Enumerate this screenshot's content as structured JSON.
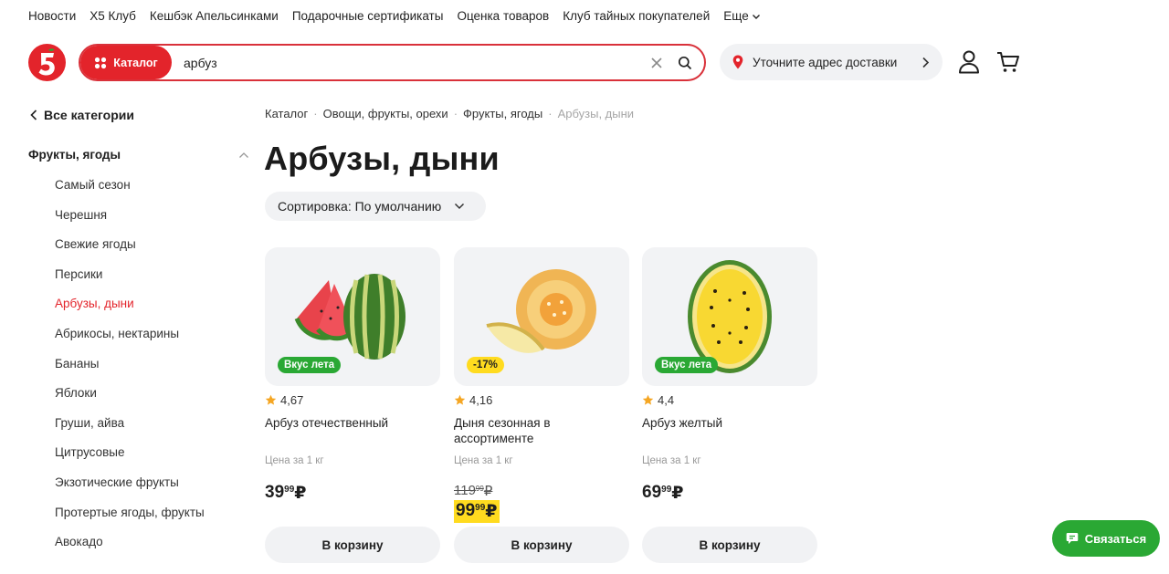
{
  "top_nav": [
    "Новости",
    "Х5 Клуб",
    "Кешбэк Апельсинками",
    "Подарочные сертификаты",
    "Оценка товаров",
    "Клуб тайных покупателей"
  ],
  "top_nav_more": "Еще",
  "header": {
    "catalog_label": "Каталог",
    "search_value": "арбуз",
    "address_label": "Уточните адрес доставки"
  },
  "sidebar": {
    "back_label": "Все категории",
    "category": "Фрукты, ягоды",
    "items": [
      "Самый сезон",
      "Черешня",
      "Свежие ягоды",
      "Персики",
      "Арбузы, дыни",
      "Абрикосы, нектарины",
      "Бананы",
      "Яблоки",
      "Груши, айва",
      "Цитрусовые",
      "Экзотические фрукты",
      "Протертые ягоды, фрукты",
      "Авокадо"
    ],
    "active_index": 4
  },
  "breadcrumb": [
    "Каталог",
    "Овощи, фрукты, орехи",
    "Фрукты, ягоды",
    "Арбузы, дыни"
  ],
  "page_title": "Арбузы, дыни",
  "sort_label": "Сортировка: По умолчанию",
  "products": [
    {
      "badge": "Вкус лета",
      "badge_color": "#2aa834",
      "rating": "4,67",
      "name": "Арбуз отечественный",
      "unit": "Цена за 1 кг",
      "price_rub": "39",
      "price_kop": "99",
      "currency": "₽",
      "button": "В корзину"
    },
    {
      "badge": "-17%",
      "badge_color": "#ffdb1f",
      "rating": "4,16",
      "name": "Дыня сезонная в ассортименте",
      "unit": "Цена за 1 кг",
      "old_price_rub": "119",
      "old_price_kop": "99",
      "price_rub": "99",
      "price_kop": "99",
      "currency": "₽",
      "button": "В корзину"
    },
    {
      "badge": "Вкус лета",
      "badge_color": "#2aa834",
      "rating": "4,4",
      "name": "Арбуз желтый",
      "unit": "Цена за 1 кг",
      "price_rub": "69",
      "price_kop": "99",
      "currency": "₽",
      "button": "В корзину"
    }
  ],
  "chat_label": "Связаться",
  "colors": {
    "brand_red": "#e3242b",
    "green": "#2aa834",
    "promo_yellow": "#ffdb1f",
    "chip_bg": "#f1f2f4"
  },
  "icons": [
    "logo-5-icon",
    "catalog-grid-icon",
    "clear-icon",
    "search-icon",
    "location-pin-icon",
    "chevron-right-icon",
    "user-icon",
    "cart-icon",
    "chevron-left-icon",
    "chevron-up-icon",
    "chevron-down-icon",
    "star-icon",
    "chat-icon"
  ]
}
